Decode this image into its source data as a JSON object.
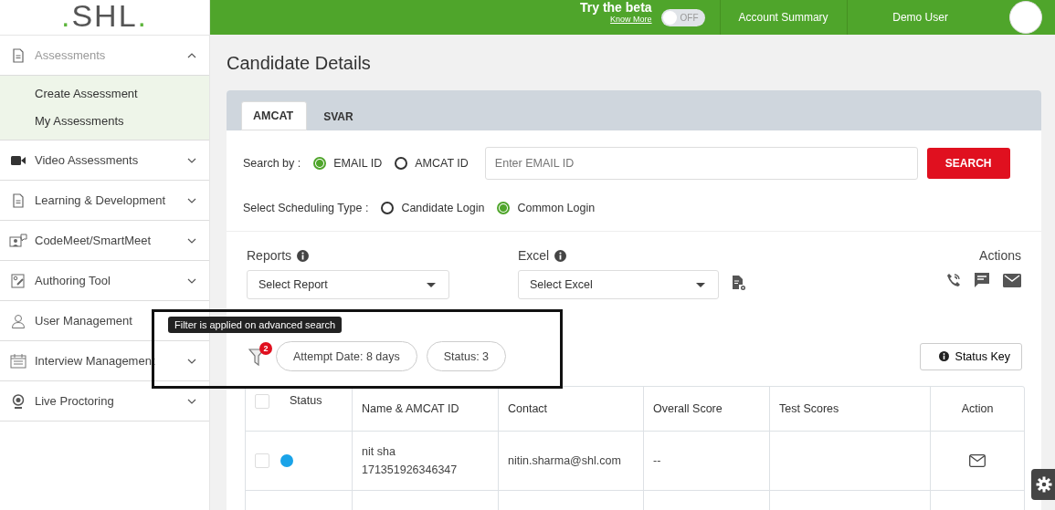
{
  "logo": {
    "prefix": ".",
    "name": "SHL",
    "suffix": "."
  },
  "header": {
    "beta_text": "Try the beta",
    "know_more": "Know More",
    "toggle": {
      "label": "OFF",
      "on": false
    },
    "links": [
      "Account Summary",
      "Demo User"
    ]
  },
  "sidebar": {
    "items": [
      {
        "label": "Assessments",
        "expanded": true,
        "disabled": true,
        "children": [
          {
            "label": "Create Assessment"
          },
          {
            "label": "My Assessments"
          }
        ]
      },
      {
        "label": "Video Assessments",
        "expanded": false,
        "disabled": false
      },
      {
        "label": "Learning & Development",
        "expanded": false,
        "disabled": false
      },
      {
        "label": "CodeMeet/SmartMeet",
        "expanded": false,
        "disabled": false
      },
      {
        "label": "Authoring Tool",
        "expanded": false,
        "disabled": false
      },
      {
        "label": "User Management",
        "expanded": false,
        "disabled": false
      },
      {
        "label": "Interview Management",
        "expanded": false,
        "disabled": false
      },
      {
        "label": "Live Proctoring",
        "expanded": false,
        "disabled": false
      }
    ]
  },
  "page_title": "Candidate Details",
  "tabs": [
    {
      "label": "AMCAT",
      "selected": true
    },
    {
      "label": "SVAR",
      "selected": false
    }
  ],
  "search": {
    "label": "Search by :",
    "options": [
      {
        "label": "EMAIL ID",
        "selected": true
      },
      {
        "label": "AMCAT ID",
        "selected": false
      }
    ],
    "placeholder": "Enter EMAIL ID",
    "button": "SEARCH"
  },
  "scheduling": {
    "label": "Select Scheduling Type :",
    "options": [
      {
        "label": "Candidate Login",
        "selected": false
      },
      {
        "label": "Common Login",
        "selected": true
      }
    ]
  },
  "reports": {
    "label": "Reports",
    "select": "Select Report"
  },
  "excel": {
    "label": "Excel",
    "select": "Select Excel"
  },
  "actions": {
    "label": "Actions"
  },
  "filter": {
    "tooltip": "Filter is applied on advanced search",
    "count": "2",
    "chips": [
      "Attempt Date: 8 days",
      "Status: 3"
    ]
  },
  "status_key": "Status Key",
  "table": {
    "select_all_checked": false,
    "columns": [
      "Status",
      "Name & AMCAT ID",
      "Contact",
      "Overall Score",
      "Test Scores",
      "Action"
    ],
    "rows": [
      {
        "checked": false,
        "color": "#1aa3e8",
        "name": "nit sha",
        "amcat_id": "171351926346347",
        "contact": "nitin.sharma@shl.com",
        "overall": "--"
      }
    ]
  }
}
